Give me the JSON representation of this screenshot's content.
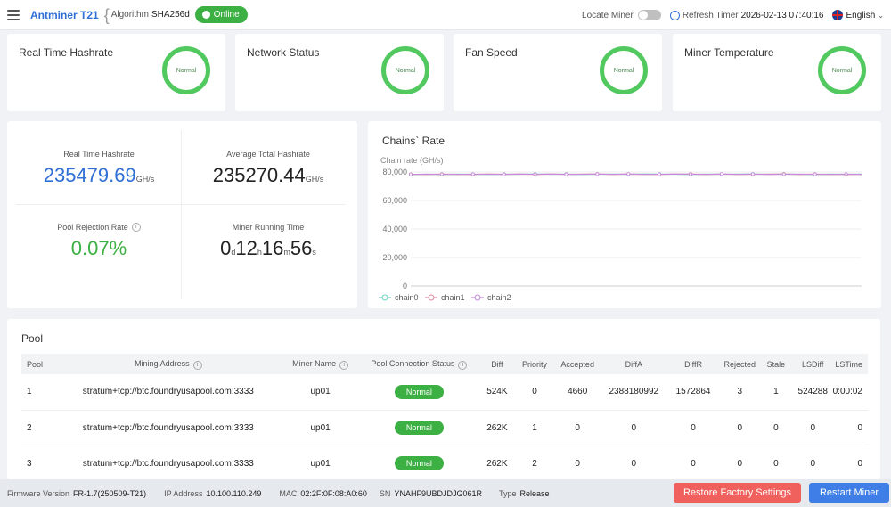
{
  "header": {
    "brand": "Antminer T21",
    "algorithm_label": "Algorithm",
    "algorithm_value": "SHA256d",
    "status": "Online",
    "locate_miner_label": "Locate Miner",
    "refresh_label": "Refresh Timer",
    "timestamp": "2026-02-13 07:40:16",
    "language": "English"
  },
  "status_cards": [
    {
      "label": "Real Time Hashrate",
      "state": "Normal"
    },
    {
      "label": "Network Status",
      "state": "Normal"
    },
    {
      "label": "Fan Speed",
      "state": "Normal"
    },
    {
      "label": "Miner Temperature",
      "state": "Normal"
    }
  ],
  "stats": {
    "realtime_label": "Real Time Hashrate",
    "realtime_value": "235479.69",
    "realtime_unit": "GH/s",
    "average_label": "Average Total Hashrate",
    "average_value": "235270.44",
    "average_unit": "GH/s",
    "rejection_label": "Pool Rejection Rate",
    "rejection_value": "0.07%",
    "running_label": "Miner Running Time",
    "running": {
      "d": "0",
      "d_unit": "d",
      "h": "12",
      "h_unit": "h",
      "m": "16",
      "m_unit": "m",
      "s": "56",
      "s_unit": "s"
    }
  },
  "colors": {
    "accent": "#2f6fd6",
    "online": "#3cb043",
    "rejection": "#3cb043",
    "ring": "#52c95f",
    "restore_button": "#f0605d",
    "restart_button": "#3e7ee6",
    "chain0": "#6fd3c2",
    "chain1": "#d98aa0",
    "chain2": "#c68ad9"
  },
  "chart_data": {
    "type": "line",
    "title": "Chains` Rate",
    "ylabel": "Chain rate (GH/s)",
    "ylim": [
      0,
      80000
    ],
    "yticks": [
      "0",
      "20,000",
      "40,000",
      "60,000",
      "80,000"
    ],
    "grid": true,
    "legend": "bottom-left",
    "series": [
      {
        "name": "chain0",
        "values": [
          78200,
          78400,
          78300,
          78500,
          78400,
          78300,
          78500,
          78400,
          78600,
          78400,
          78500,
          78300,
          78400,
          78500,
          78400,
          78600,
          78500,
          78400,
          78300,
          78500,
          78400,
          78500,
          78600,
          78400,
          78500,
          78400,
          78300,
          78500,
          78400,
          78500
        ]
      },
      {
        "name": "chain1",
        "values": [
          78400,
          78300,
          78500,
          78400,
          78300,
          78600,
          78400,
          78500,
          78300,
          78600,
          78400,
          78500,
          78600,
          78300,
          78500,
          78400,
          78300,
          78500,
          78600,
          78400,
          78500,
          78300,
          78400,
          78500,
          78600,
          78300,
          78500,
          78400,
          78300,
          78400
        ]
      },
      {
        "name": "chain2",
        "values": [
          78300,
          78500,
          78400,
          78300,
          78500,
          78400,
          78300,
          78600,
          78400,
          78500,
          78300,
          78400,
          78500,
          78400,
          78600,
          78300,
          78400,
          78600,
          78400,
          78300,
          78600,
          78400,
          78500,
          78300,
          78400,
          78500,
          78400,
          78300,
          78500,
          78300
        ]
      }
    ]
  },
  "pool": {
    "title": "Pool",
    "columns": [
      "Pool",
      "Mining Address",
      "Miner Name",
      "Pool Connection Status",
      "Diff",
      "Priority",
      "Accepted",
      "DiffA",
      "DiffR",
      "Rejected",
      "Stale",
      "LSDiff",
      "LSTime"
    ],
    "rows": [
      {
        "pool": "1",
        "address": "stratum+tcp://btc.foundryusapool.com:3333",
        "miner": "up01",
        "status": "Normal",
        "diff": "524K",
        "priority": "0",
        "accepted": "4660",
        "diffa": "2388180992",
        "diffr": "1572864",
        "rejected": "3",
        "stale": "1",
        "lsdiff": "524288",
        "lstime": "0:00:02"
      },
      {
        "pool": "2",
        "address": "stratum+tcp://btc.foundryusapool.com:3333",
        "miner": "up01",
        "status": "Normal",
        "diff": "262K",
        "priority": "1",
        "accepted": "0",
        "diffa": "0",
        "diffr": "0",
        "rejected": "0",
        "stale": "0",
        "lsdiff": "0",
        "lstime": "0"
      },
      {
        "pool": "3",
        "address": "stratum+tcp://btc.foundryusapool.com:3333",
        "miner": "up01",
        "status": "Normal",
        "diff": "262K",
        "priority": "2",
        "accepted": "0",
        "diffa": "0",
        "diffr": "0",
        "rejected": "0",
        "stale": "0",
        "lsdiff": "0",
        "lstime": "0"
      }
    ]
  },
  "footer": {
    "firmware_label": "Firmware Version",
    "firmware": "FR-1.7(250509-T21)",
    "ip_label": "IP Address",
    "ip": "10.100.110.249",
    "mac_label": "MAC",
    "mac": "02:2F:0F:08:A0:60",
    "sn_label": "SN",
    "sn": "YNAHF9UBDJDJG061R",
    "type_label": "Type",
    "type": "Release",
    "restore_button": "Restore Factory Settings",
    "restart_button": "Restart Miner"
  }
}
